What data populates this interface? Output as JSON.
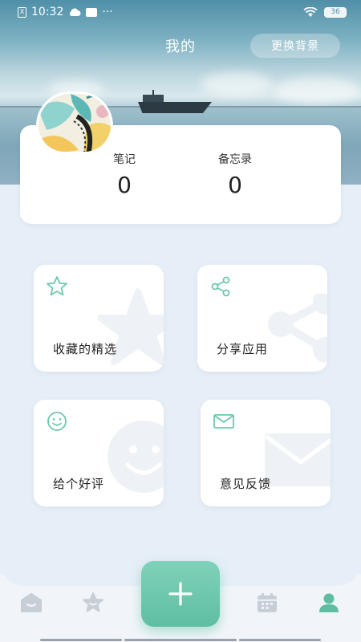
{
  "status_bar": {
    "time": "10:32",
    "sim_label": "X",
    "dots": "···",
    "battery": "36"
  },
  "header": {
    "title": "我的",
    "change_bg_label": "更换背景"
  },
  "profile": {
    "stats": [
      {
        "label": "笔记",
        "value": "0"
      },
      {
        "label": "备忘录",
        "value": "0"
      }
    ]
  },
  "grid": {
    "items": [
      {
        "label": "收藏的精选",
        "icon": "star-icon"
      },
      {
        "label": "分享应用",
        "icon": "share-icon"
      },
      {
        "label": "给个好评",
        "icon": "smiley-icon"
      },
      {
        "label": "意见反馈",
        "icon": "mail-icon"
      }
    ]
  },
  "nav": {
    "items": [
      {
        "icon": "home-icon"
      },
      {
        "icon": "star-icon"
      },
      {
        "icon": "add-icon"
      },
      {
        "icon": "calendar-icon"
      },
      {
        "icon": "user-icon"
      }
    ],
    "accent": "#5fbea2"
  },
  "colors": {
    "accent": "#6cc7ae",
    "inactive_nav": "#c8ced6",
    "page_bg": "#e6eef7"
  }
}
